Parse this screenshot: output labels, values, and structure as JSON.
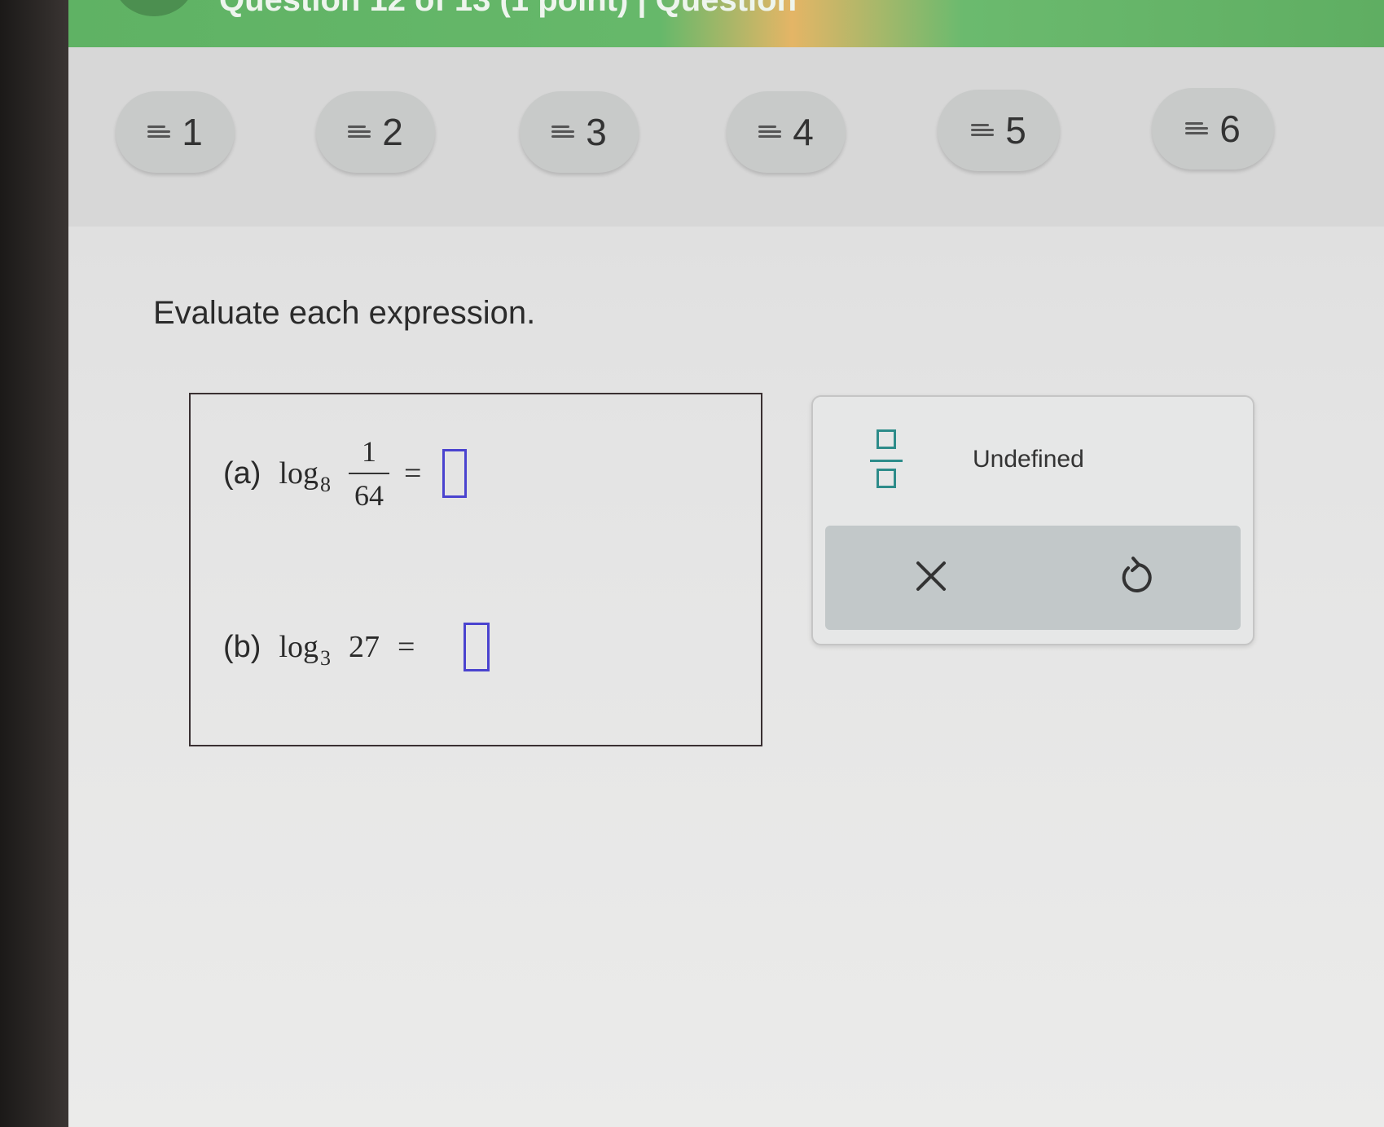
{
  "header": {
    "title": "Question 12 of 13 (1 point)  |  Question"
  },
  "question_nav": [
    {
      "label": "1"
    },
    {
      "label": "2"
    },
    {
      "label": "3"
    },
    {
      "label": "4"
    },
    {
      "label": "5"
    },
    {
      "label": "6"
    }
  ],
  "question": {
    "prompt": "Evaluate each expression.",
    "part_a": {
      "label": "(a)",
      "func": "log",
      "base": "8",
      "numerator": "1",
      "denominator": "64",
      "equals": "=",
      "answer": ""
    },
    "part_b": {
      "label": "(b)",
      "func": "log",
      "base": "3",
      "argument": "27",
      "equals": "=",
      "answer": ""
    }
  },
  "palette": {
    "fraction_icon": "fraction-template-icon",
    "undefined_label": "Undefined",
    "clear_icon": "x-icon",
    "undo_icon": "undo-icon"
  },
  "colors": {
    "header_green": "#5fb264",
    "answer_box": "#4a43cf",
    "palette_accent": "#2d8c8a"
  }
}
